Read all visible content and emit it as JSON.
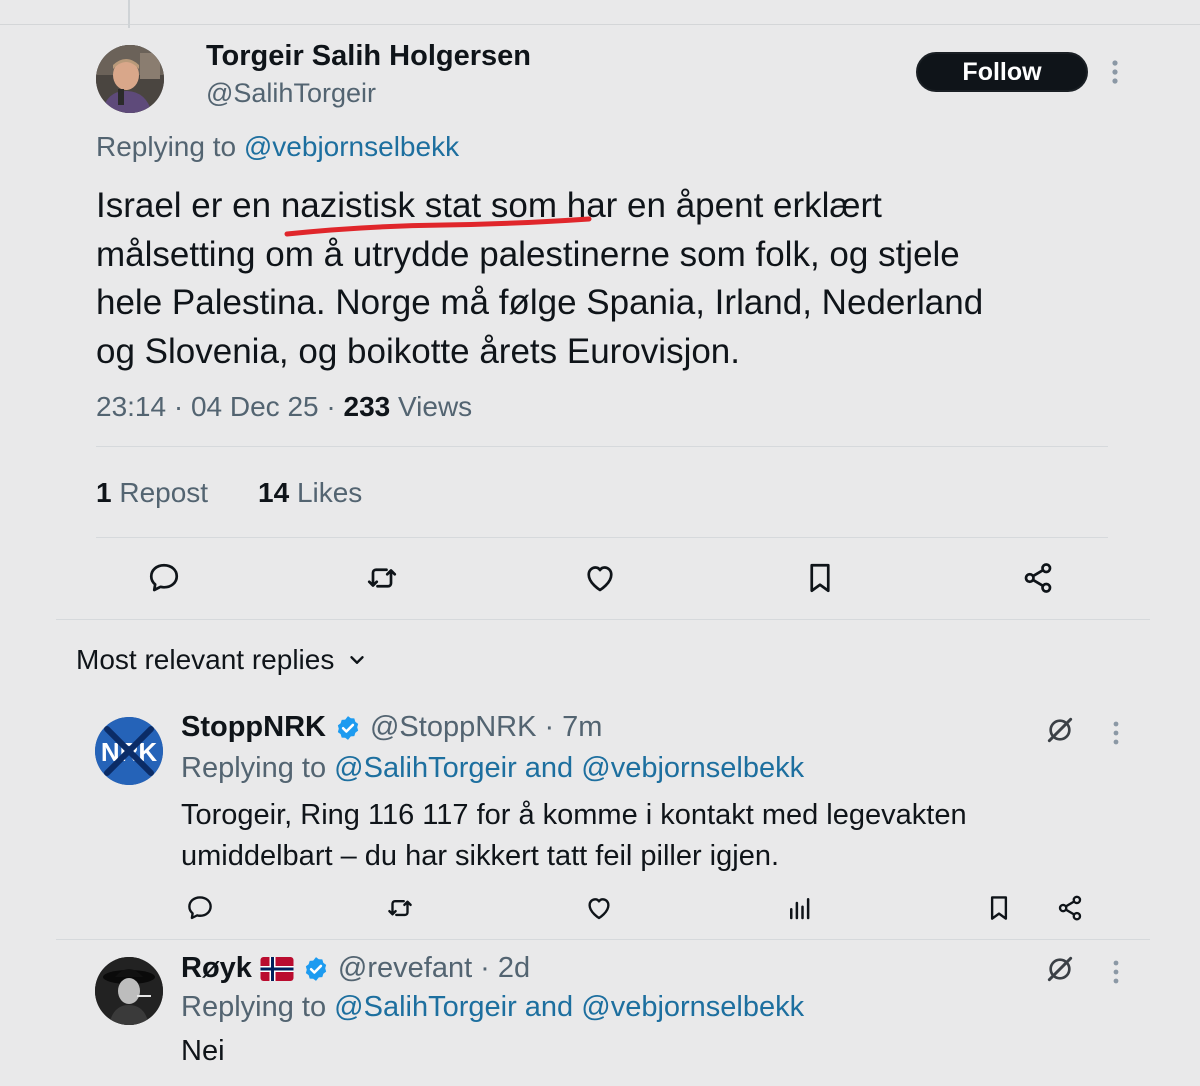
{
  "tweet": {
    "author_name": "Torgeir Salih Holgersen",
    "author_handle": "@SalihTorgeir",
    "follow_label": "Follow",
    "replying_prefix": "Replying to",
    "replying_to": "@vebjornselbekk",
    "body_line1_a": "Israel er en ",
    "body_line1_b": "nazistisk stat so",
    "body_line1_c": "m har en åpent erklært",
    "body_line2": "målsetting om å utrydde palestinerne som folk, og stjele",
    "body_line3": "hele Palestina. Norge må følge Spania, Irland, Nederland",
    "body_line4": "og Slovenia, og boikotte årets Eurovisjon.",
    "time": "23:14",
    "date": "04 Dec 25",
    "views_count": "233",
    "views_label": "Views",
    "reposts_count": "1",
    "reposts_label": "Repost",
    "likes_count": "14",
    "likes_label": "Likes",
    "annotation_color": "#e0262b"
  },
  "replies_header": {
    "label": "Most relevant replies"
  },
  "replies": [
    {
      "name": "StoppNRK",
      "handle": "@StoppNRK",
      "time": "7m",
      "replying_prefix": "Replying to",
      "replying_a": "@SalihTorgeir",
      "replying_and": "and",
      "replying_b": "@vebjornselbekk",
      "text_line1": "Torogeir, Ring 116 117 for å komme i kontakt med legevakten",
      "text_line2": "umiddelbart – du har sikkert tatt feil piller igjen.",
      "avatar_text": "NRK"
    },
    {
      "name": "Røyk",
      "handle": "@revefant",
      "time": "2d",
      "replying_prefix": "Replying to",
      "replying_a": "@SalihTorgeir",
      "replying_and": "and",
      "replying_b": "@vebjornselbekk",
      "text_line1": "Nei"
    }
  ],
  "colors": {
    "verified": "#1d9bf0",
    "link": "#1d6f9f",
    "muted": "#536471",
    "background": "#e9e9ea"
  }
}
